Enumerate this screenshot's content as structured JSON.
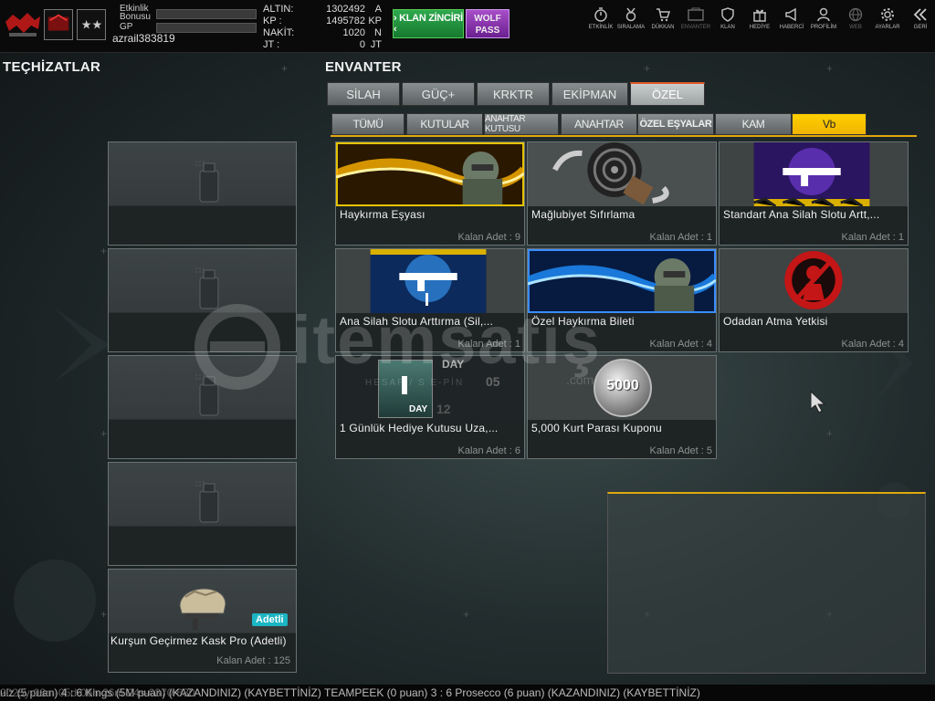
{
  "user": {
    "bonus_label_1": "Etkinlik",
    "bonus_label_2": "Bonusu",
    "gp_label": "GP",
    "username": "azrail383819"
  },
  "currency": [
    {
      "label": "ALTIN:",
      "value": "1302492",
      "unit": "A"
    },
    {
      "label": "KP  :",
      "value": "1495782",
      "unit": "KP"
    },
    {
      "label": "NAKİT:",
      "value": "1020",
      "unit": "N"
    },
    {
      "label": "JT   :",
      "value": "0",
      "unit": "JT"
    }
  ],
  "buttons": {
    "klan_zinciri": "› KLAN ZİNCİRİ ‹",
    "wolf_pass_1": "WOLF",
    "wolf_pass_2": "PASS"
  },
  "nav": [
    {
      "label": "ETKİNLİK",
      "icon": "stopwatch-icon"
    },
    {
      "label": "SIRALAMA",
      "icon": "medal-icon"
    },
    {
      "label": "DÜKKAN",
      "icon": "cart-icon"
    },
    {
      "label": "ENVANTER",
      "icon": "inventory-icon"
    },
    {
      "label": "KLAN",
      "icon": "shield-icon"
    },
    {
      "label": "HEDİYE",
      "icon": "gift-icon"
    },
    {
      "label": "HABERCİ",
      "icon": "megaphone-icon"
    },
    {
      "label": "PROFİLİM",
      "icon": "profile-icon"
    },
    {
      "label": "WEB",
      "icon": "globe-icon"
    },
    {
      "label": "AYARLAR",
      "icon": "gear-icon"
    },
    {
      "label": "GERİ",
      "icon": "back-chevron-icon"
    }
  ],
  "equipment": {
    "title": "TEÇHİZATLAR",
    "helmet": {
      "name": "Kurşun Geçirmez Kask Pro (Adetli)",
      "badge": "Adetli",
      "count": "Kalan Adet : 125"
    }
  },
  "inventory": {
    "title": "ENVANTER",
    "tabs": [
      "SİLAH",
      "GÜÇ+",
      "KRKTR",
      "EKİPMAN",
      "ÖZEL"
    ],
    "active_tab": "ÖZEL",
    "subtabs": [
      "TÜMÜ",
      "KUTULAR",
      "ANAHTAR KUTUSU",
      "ANAHTAR",
      "ÖZEL EŞYALAR",
      "KAM",
      "Vb"
    ],
    "active_subtab": "Vb",
    "items": [
      {
        "name": "Haykırma Eşyası",
        "count": "Kalan Adet : 9"
      },
      {
        "name": "Mağlubiyet  Sıfırlama",
        "count": "Kalan Adet : 1"
      },
      {
        "name": "Standart Ana Silah Slotu Artt,...",
        "count": "Kalan Adet : 1"
      },
      {
        "name": "Ana Silah Slotu Arttırma (Sil,...",
        "count": "Kalan Adet : 1"
      },
      {
        "name": "Özel Haykırma Bileti",
        "count": "Kalan Adet : 4"
      },
      {
        "name": "Odadan Atma Yetkisi",
        "count": "Kalan Adet : 4"
      },
      {
        "name": "1 Günlük Hediye Kutusu Uza,...",
        "count": "Kalan Adet : 6",
        "img_text_day": "DAY",
        "img_text_num": "05",
        "img_text_num2": "12"
      },
      {
        "name": "5,000 Kurt Parası Kuponu",
        "count": "Kalan Adet : 5",
        "img_text": "5000"
      }
    ]
  },
  "watermark": {
    "brand": "itemsatış",
    "tagline": "HESAP / S               E-PİN",
    "domain": ".com"
  },
  "ticker": "ulz (5 puan) 4 : 6 Kings (5M puan) (KAZANDINIZ)        (KAYBETTİNİZ) TEAMPEEK (0 puan) 3 : 6 Prosecco (6 puan) (KAZANDINIZ)        (KAYBETTİNİZ)",
  "ticker_overlay": "2025y-08m-05d-06h-26m-24s-0370-680"
}
